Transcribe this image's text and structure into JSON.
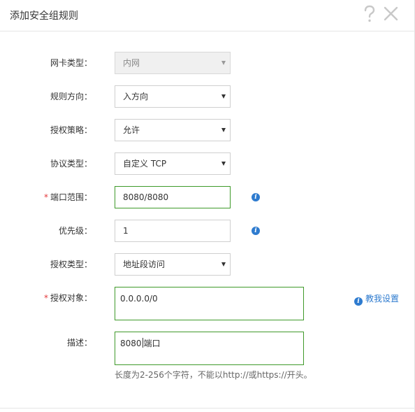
{
  "dialog": {
    "title": "添加安全组规则",
    "help_icon": "question-mark-icon",
    "close_icon": "close-x-icon"
  },
  "form": {
    "nic_type": {
      "label": "网卡类型：",
      "value": "内网",
      "disabled": true
    },
    "direction": {
      "label": "规则方向：",
      "value": "入方向"
    },
    "policy": {
      "label": "授权策略：",
      "value": "允许"
    },
    "protocol": {
      "label": "协议类型：",
      "value": "自定义 TCP"
    },
    "port_range": {
      "required_mark": "*",
      "label": "端口范围：",
      "value": "8080/8080"
    },
    "priority": {
      "label": "优先级：",
      "value": "1"
    },
    "auth_type": {
      "label": "授权类型：",
      "value": "地址段访问"
    },
    "auth_object": {
      "required_mark": "*",
      "label": "授权对象：",
      "value": "0.0.0.0/0",
      "help_link": "教我设置"
    },
    "description": {
      "label": "描述：",
      "value_before_cursor": "8080",
      "value_after_cursor": "端口",
      "hint": "长度为2-256个字符，不能以http://或https://开头。"
    }
  },
  "colors": {
    "focus_border": "#3f9a2a",
    "info_blue": "#2e7bcf",
    "required_red": "#e4393c"
  }
}
